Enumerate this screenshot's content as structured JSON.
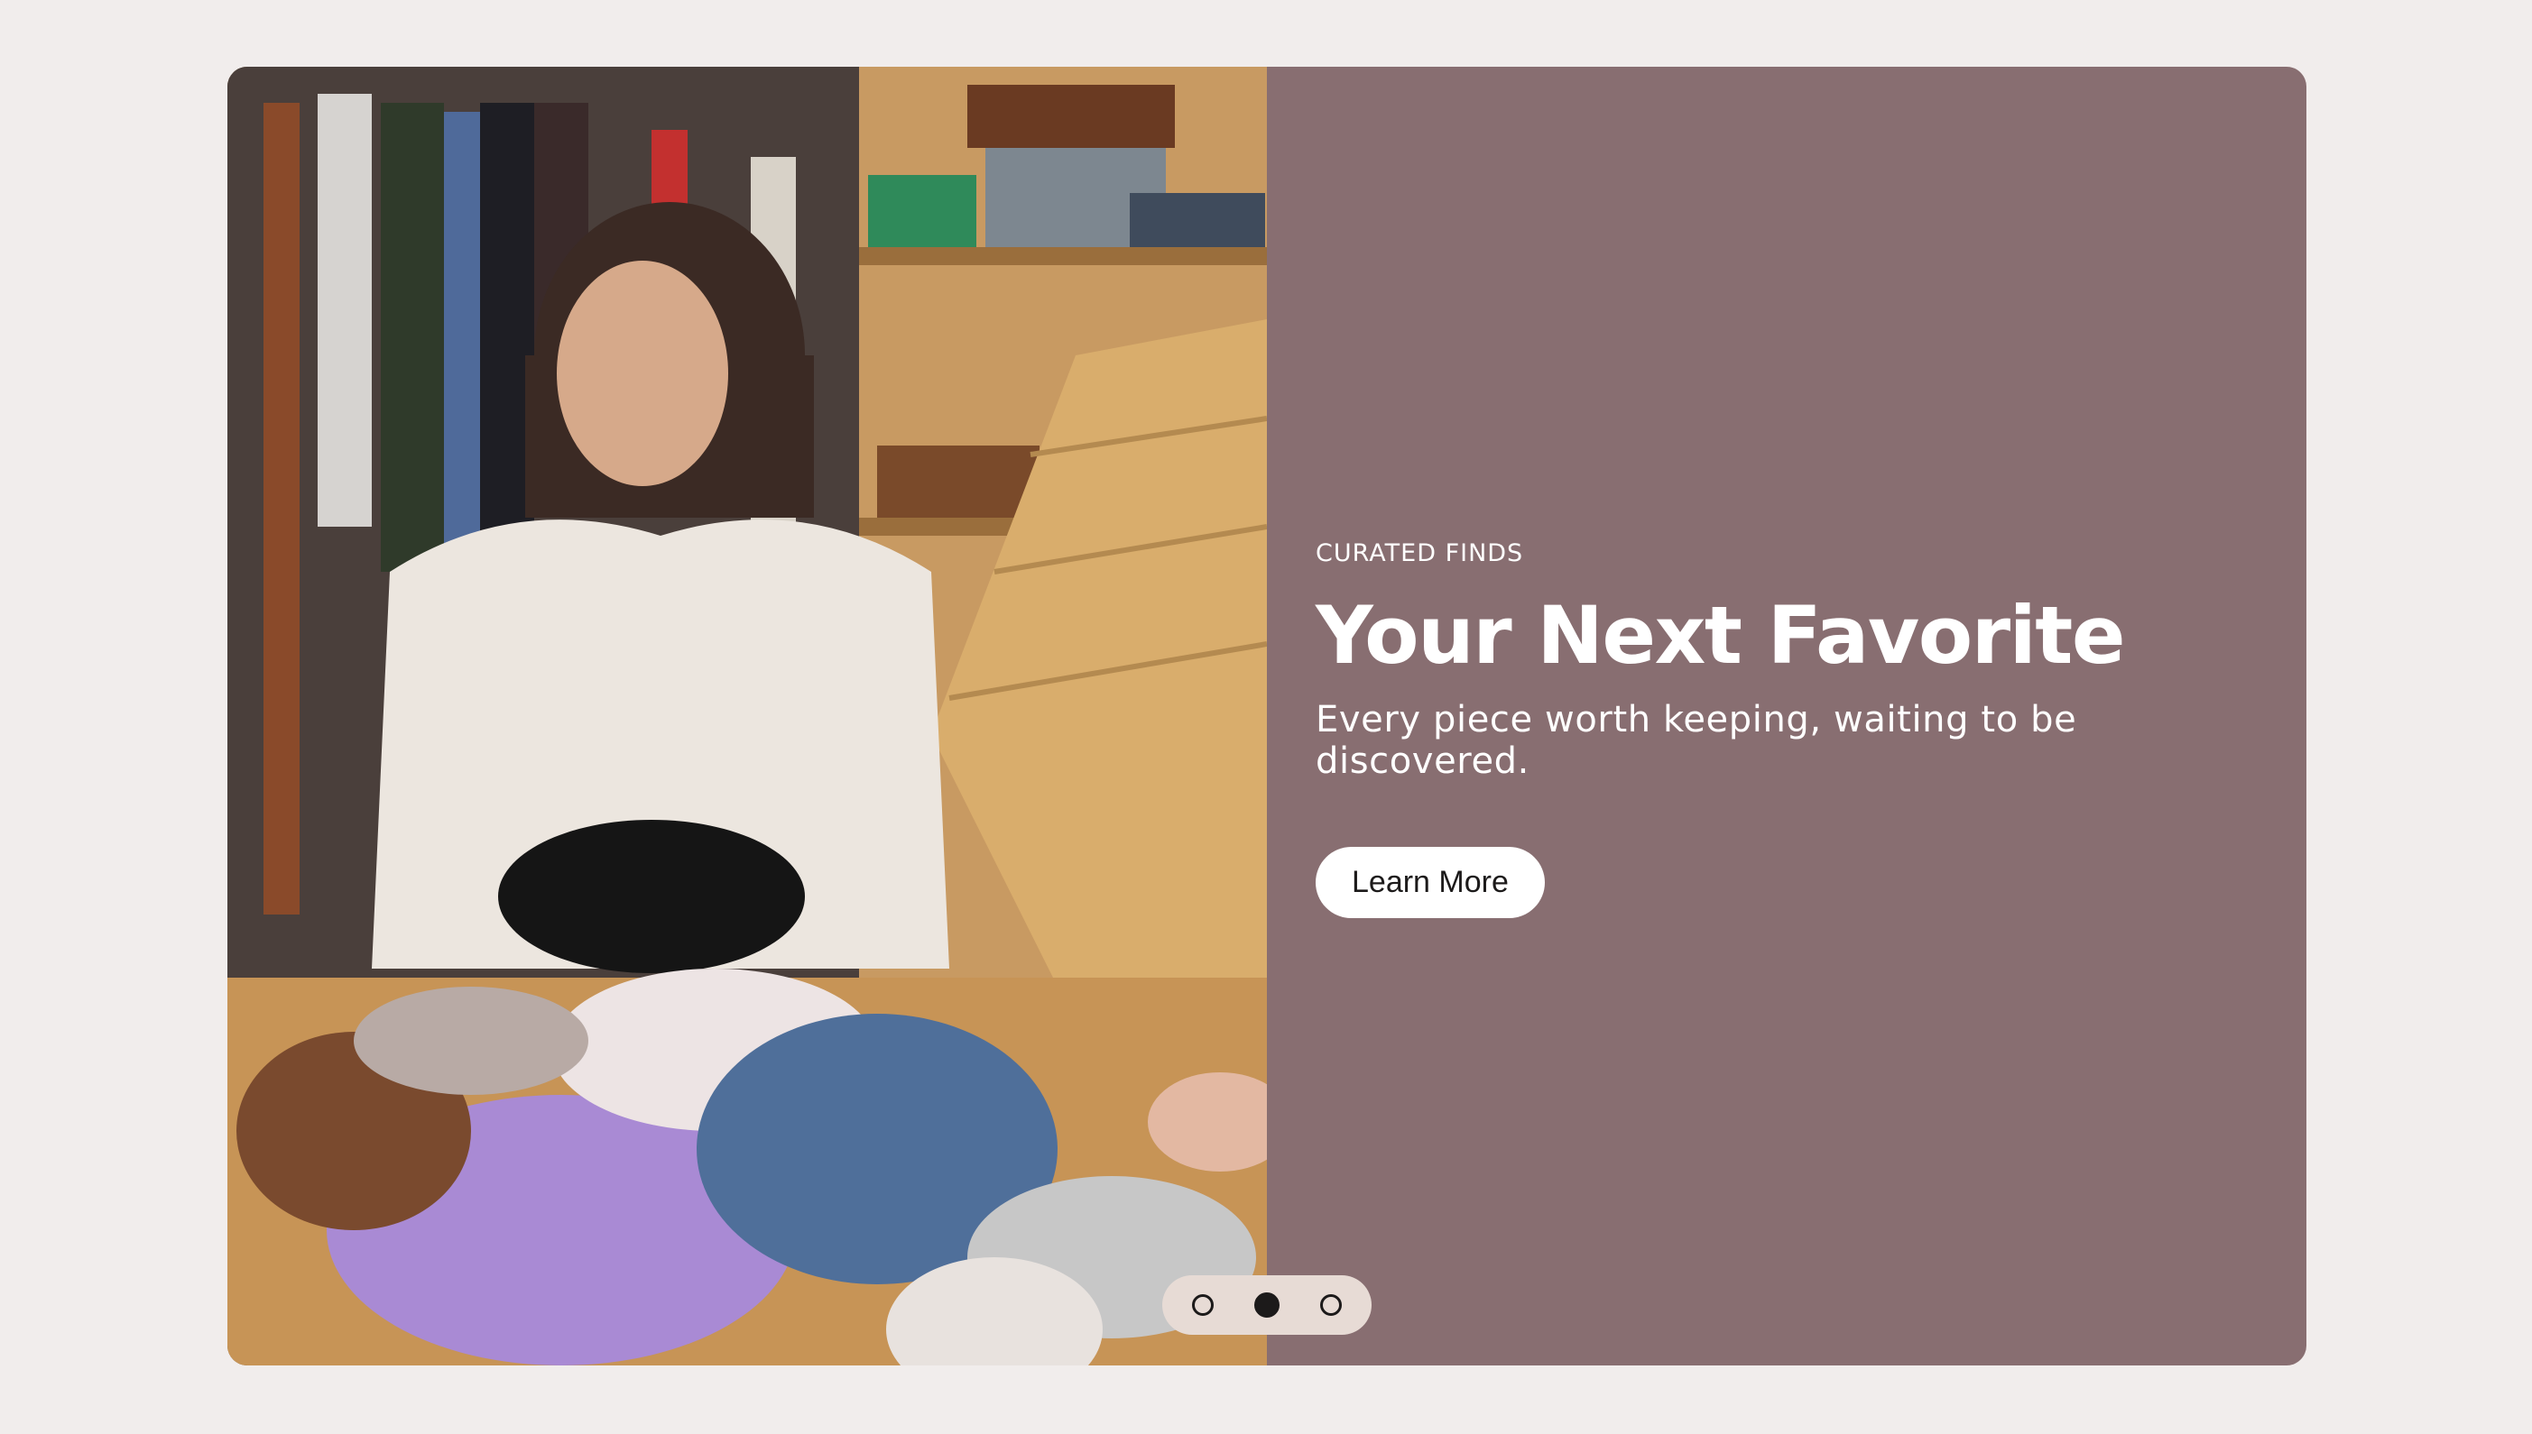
{
  "hero": {
    "eyebrow": "CURATED FINDS",
    "headline": "Your Next Favorite",
    "subtitle": "Every piece worth keeping, waiting to be discovered.",
    "cta_label": "Learn More",
    "panel_color": "#886e71"
  },
  "carousel": {
    "total_slides": 3,
    "active_slide": 2
  },
  "image": {
    "subject": "woman-sorting-vintage-clothing-in-wooden-crate"
  }
}
